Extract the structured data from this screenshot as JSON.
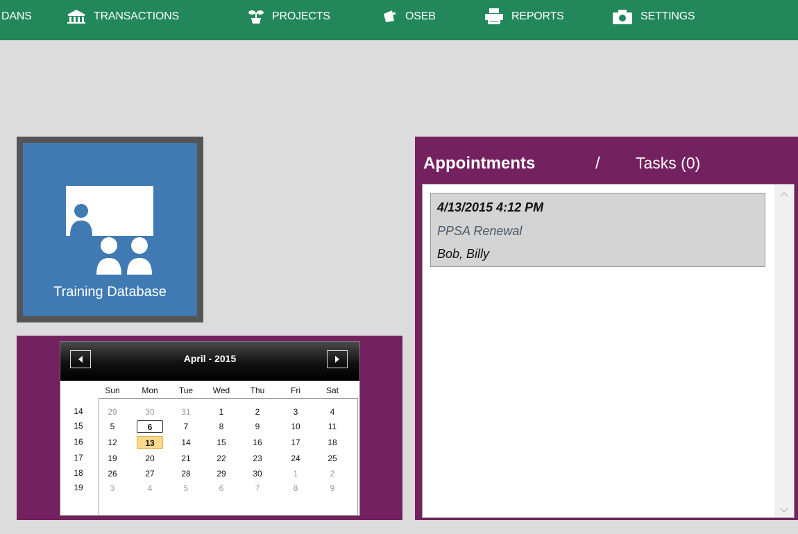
{
  "nav": {
    "items": [
      {
        "label": "DANS",
        "icon": "none"
      },
      {
        "label": "TRANSACTIONS",
        "icon": "bank-icon"
      },
      {
        "label": "PROJECTS",
        "icon": "plant-icon"
      },
      {
        "label": "OSEB",
        "icon": "megaphone-icon"
      },
      {
        "label": "REPORTS",
        "icon": "printer-icon"
      },
      {
        "label": "SETTINGS",
        "icon": "camera-icon"
      }
    ],
    "color": "#22875a"
  },
  "tile": {
    "label": "Training Database",
    "icon": "presentation-icon",
    "color": "#3f7ab3"
  },
  "calendar": {
    "title": "April - 2015",
    "prev_icon": "triangle-left-icon",
    "next_icon": "triangle-right-icon",
    "days_of_week": [
      "Sun",
      "Mon",
      "Tue",
      "Wed",
      "Thu",
      "Fri",
      "Sat"
    ],
    "weeks": [
      {
        "num": "14",
        "days": [
          "29",
          "30",
          "31",
          "1",
          "2",
          "3",
          "4"
        ]
      },
      {
        "num": "15",
        "days": [
          "5",
          "6",
          "7",
          "8",
          "9",
          "10",
          "11"
        ]
      },
      {
        "num": "16",
        "days": [
          "12",
          "13",
          "14",
          "15",
          "16",
          "17",
          "18"
        ]
      },
      {
        "num": "17",
        "days": [
          "19",
          "20",
          "21",
          "22",
          "23",
          "24",
          "25"
        ]
      },
      {
        "num": "18",
        "days": [
          "26",
          "27",
          "28",
          "29",
          "30",
          "1",
          "2"
        ]
      },
      {
        "num": "19",
        "days": [
          "3",
          "4",
          "5",
          "6",
          "7",
          "8",
          "9"
        ]
      }
    ],
    "selected_day": "6",
    "today_day": "13",
    "today_color": "#fbd98b"
  },
  "appointments": {
    "tab_appointments": "Appointments",
    "separator": "/",
    "tab_tasks": "Tasks (0)",
    "items": [
      {
        "datetime": "4/13/2015 4:12 PM",
        "subject": "PPSA Renewal",
        "people": "Bob, Billy"
      }
    ],
    "panel_color": "#74215f"
  }
}
